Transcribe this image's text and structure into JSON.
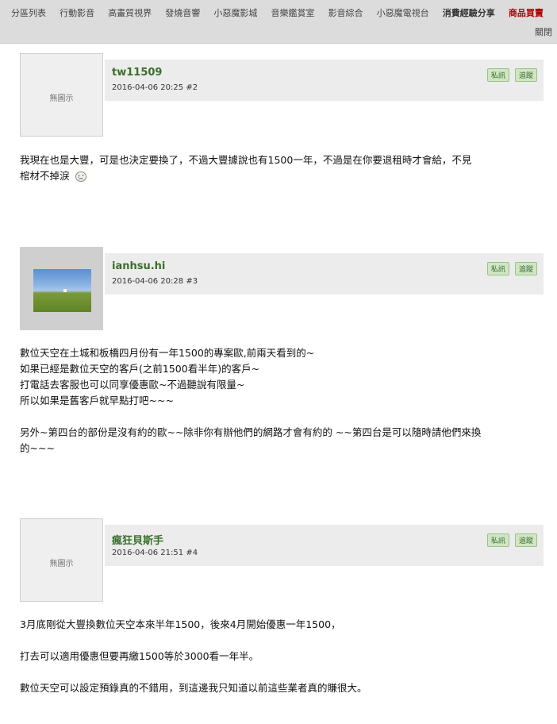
{
  "nav": {
    "items": [
      {
        "label": "分區列表",
        "style": "normal"
      },
      {
        "label": "行動影音",
        "style": "normal"
      },
      {
        "label": "高畫質視界",
        "style": "normal"
      },
      {
        "label": "發燒音響",
        "style": "normal"
      },
      {
        "label": "小惡魔影城",
        "style": "normal"
      },
      {
        "label": "音樂鑑賞室",
        "style": "normal"
      },
      {
        "label": "影音綜合",
        "style": "normal"
      },
      {
        "label": "小惡魔電視台",
        "style": "normal"
      },
      {
        "label": "消費經驗分享",
        "style": "bold"
      },
      {
        "label": "商品買賣",
        "style": "red"
      }
    ],
    "close_label": "關閉"
  },
  "buttons": {
    "pm_label": "私訊",
    "follow_label": "追蹤"
  },
  "posts": [
    {
      "author": "tw11509",
      "datetime": "2016-04-06 20:25",
      "floor": "#2",
      "avatar_text": "無圖示",
      "paragraphs": [
        "我現在也是大豐，可是也決定要換了，不過大豐據說也有1500一年，不過是在你要退租時才會給，不見",
        "棺材不掉淚"
      ]
    },
    {
      "author": "ianhsu.hi",
      "datetime": "2016-04-06 20:28",
      "floor": "#3",
      "paragraphs": [
        "數位天空在土城和板橋四月份有一年1500的專案歐,前兩天看到的~",
        "如果已經是數位天空的客戶(之前1500看半年)的客戶~",
        "打電話去客服也可以同享優惠歐~不過聽說有限量~",
        "所以如果是舊客戶就早點打吧~~~",
        "",
        "另外~第四台的部份是沒有約的歐~~除非你有辦他們的網路才會有約的 ~~第四台是可以隨時請他們來換",
        "的~~~"
      ]
    },
    {
      "author": "瘋狂貝斯手",
      "datetime": "2016-04-06 21:51",
      "floor": "#4",
      "avatar_text": "無圖示",
      "paragraphs": [
        "3月底剛從大豐換數位天空本來半年1500，後來4月開始優惠一年1500，",
        "",
        "打去可以適用優惠但要再繳1500等於3000看一年半。",
        "",
        "數位天空可以設定預錄真的不錯用，到這邊我只知道以前這些業者真的賺很大。"
      ]
    }
  ]
}
